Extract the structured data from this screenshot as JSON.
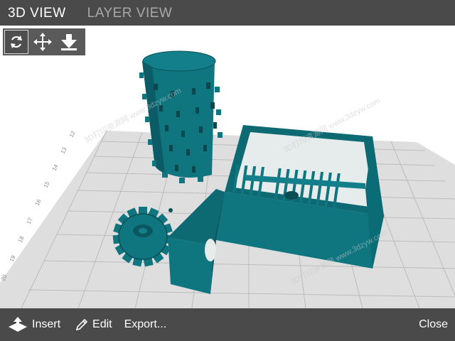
{
  "tabs": [
    {
      "label": "3D VIEW",
      "active": true
    },
    {
      "label": "LAYER VIEW",
      "active": false
    }
  ],
  "toolbar": {
    "tools": [
      {
        "icon": "rotate-icon",
        "selected": true
      },
      {
        "icon": "move-icon",
        "selected": false
      },
      {
        "icon": "drop-to-bed-icon",
        "selected": false
      }
    ]
  },
  "build_plate": {
    "ruler_labels": [
      "20",
      "19",
      "18",
      "17",
      "16",
      "15",
      "14",
      "13",
      "12"
    ]
  },
  "watermark": "3D打印资源网 www.3dzyw.com",
  "bottom_bar": {
    "insert_label": "Insert",
    "edit_label": "Edit",
    "export_label": "Export...",
    "close_label": "Close"
  },
  "colors": {
    "bar_bg": "#4a4a4a",
    "model_teal": "#0f7680",
    "model_dark": "#0b4f57",
    "plate": "#dedede",
    "grid": "#b8b8b8"
  }
}
